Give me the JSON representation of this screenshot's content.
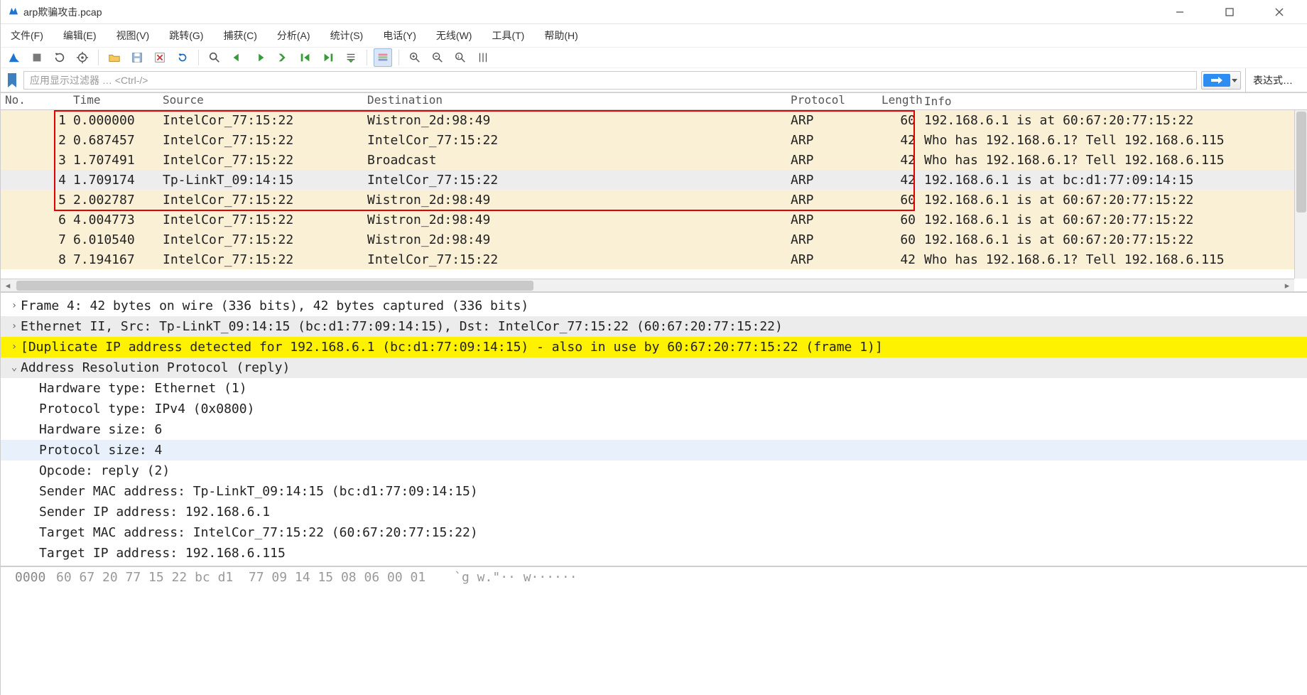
{
  "window": {
    "title": "arp欺骗攻击.pcap"
  },
  "menu": {
    "items": [
      "文件(F)",
      "编辑(E)",
      "视图(V)",
      "跳转(G)",
      "捕获(C)",
      "分析(A)",
      "统计(S)",
      "电话(Y)",
      "无线(W)",
      "工具(T)",
      "帮助(H)"
    ]
  },
  "filter": {
    "placeholder": "应用显示过滤器 … <Ctrl-/>",
    "expression_label": "表达式…"
  },
  "columns": {
    "no": "No.",
    "time": "Time",
    "source": "Source",
    "destination": "Destination",
    "protocol": "Protocol",
    "length": "Length",
    "info": "Info"
  },
  "packets": [
    {
      "no": "1",
      "time": "0.000000",
      "src": "IntelCor_77:15:22",
      "dst": "Wistron_2d:98:49",
      "proto": "ARP",
      "len": "60",
      "info": "192.168.6.1 is at 60:67:20:77:15:22",
      "cls": "arp"
    },
    {
      "no": "2",
      "time": "0.687457",
      "src": "IntelCor_77:15:22",
      "dst": "IntelCor_77:15:22",
      "proto": "ARP",
      "len": "42",
      "info": "Who has 192.168.6.1? Tell 192.168.6.115",
      "cls": "arp"
    },
    {
      "no": "3",
      "time": "1.707491",
      "src": "IntelCor_77:15:22",
      "dst": "Broadcast",
      "proto": "ARP",
      "len": "42",
      "info": "Who has 192.168.6.1? Tell 192.168.6.115",
      "cls": "arp"
    },
    {
      "no": "4",
      "time": "1.709174",
      "src": "Tp-LinkT_09:14:15",
      "dst": "IntelCor_77:15:22",
      "proto": "ARP",
      "len": "42",
      "info": "192.168.6.1 is at bc:d1:77:09:14:15",
      "cls": "selected"
    },
    {
      "no": "5",
      "time": "2.002787",
      "src": "IntelCor_77:15:22",
      "dst": "Wistron_2d:98:49",
      "proto": "ARP",
      "len": "60",
      "info": "192.168.6.1 is at 60:67:20:77:15:22",
      "cls": "arp"
    },
    {
      "no": "6",
      "time": "4.004773",
      "src": "IntelCor_77:15:22",
      "dst": "Wistron_2d:98:49",
      "proto": "ARP",
      "len": "60",
      "info": "192.168.6.1 is at 60:67:20:77:15:22",
      "cls": "arp"
    },
    {
      "no": "7",
      "time": "6.010540",
      "src": "IntelCor_77:15:22",
      "dst": "Wistron_2d:98:49",
      "proto": "ARP",
      "len": "60",
      "info": "192.168.6.1 is at 60:67:20:77:15:22",
      "cls": "arp"
    },
    {
      "no": "8",
      "time": "7.194167",
      "src": "IntelCor_77:15:22",
      "dst": "IntelCor_77:15:22",
      "proto": "ARP",
      "len": "42",
      "info": "Who has 192.168.6.1? Tell 192.168.6.115",
      "cls": "arp"
    }
  ],
  "details": {
    "frame": "Frame 4: 42 bytes on wire (336 bits), 42 bytes captured (336 bits)",
    "eth": "Ethernet II, Src: Tp-LinkT_09:14:15 (bc:d1:77:09:14:15), Dst: IntelCor_77:15:22 (60:67:20:77:15:22)",
    "dup": "[Duplicate IP address detected for 192.168.6.1 (bc:d1:77:09:14:15) - also in use by 60:67:20:77:15:22 (frame 1)]",
    "arp_header": "Address Resolution Protocol (reply)",
    "fields": [
      "Hardware type: Ethernet (1)",
      "Protocol type: IPv4 (0x0800)",
      "Hardware size: 6",
      "Protocol size: 4",
      "Opcode: reply (2)",
      "Sender MAC address: Tp-LinkT_09:14:15 (bc:d1:77:09:14:15)",
      "Sender IP address: 192.168.6.1",
      "Target MAC address: IntelCor_77:15:22 (60:67:20:77:15:22)",
      "Target IP address: 192.168.6.115"
    ],
    "hl_blue_index": 3
  },
  "bytes": {
    "addr": "0000",
    "hex": "60 67 20 77 15 22 bc d1  77 09 14 15 08 06 00 01",
    "asc": "`g w.\"·· w······"
  }
}
